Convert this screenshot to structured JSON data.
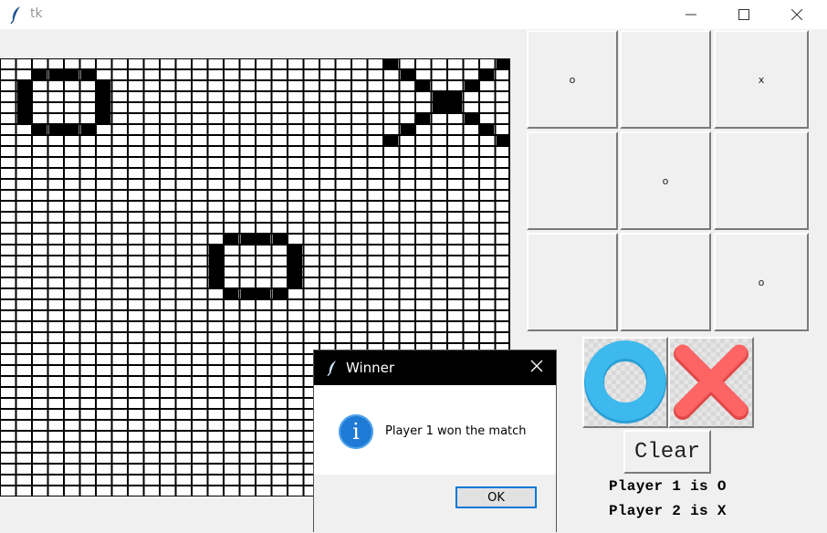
{
  "window": {
    "title": "tk",
    "minimize_icon": "minimize-icon",
    "maximize_icon": "maximize-icon",
    "close_icon": "close-icon"
  },
  "board": {
    "cells": [
      "o",
      "",
      "x",
      "",
      "o",
      "",
      "",
      "",
      "o"
    ]
  },
  "buttons": {
    "o_icon": "blue-ring-o-icon",
    "x_icon": "red-cross-x-icon",
    "clear_label": "Clear"
  },
  "labels": {
    "player1": "Player 1 is O",
    "player2": "Player 2 is X"
  },
  "dialog": {
    "title": "Winner",
    "message": "Player 1 won the match",
    "ok_label": "OK",
    "icon": "info-icon"
  },
  "colors": {
    "o_color": "#3db9ee",
    "x_color": "#ff5b5b",
    "dialog_title_bg": "#000000",
    "ok_border": "#0078d7"
  }
}
